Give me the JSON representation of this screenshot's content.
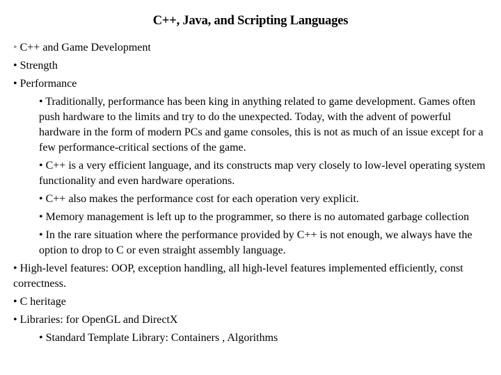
{
  "slide": {
    "title": "C++, Java, and Scripting Languages",
    "items": [
      {
        "level": 1,
        "bullet": "•",
        "bullet_color": "#9a9a9a",
        "text": "C++ and Game Development"
      },
      {
        "level": 1,
        "bullet": "•",
        "text": "Strength"
      },
      {
        "level": 1,
        "bullet": "•",
        "text": "Performance"
      },
      {
        "level": 2,
        "bullet": "•",
        "text": "Traditionally, performance has been king in anything related to game development. Games often push hardware to the limits and try to do the unexpected. Today, with the advent of powerful hardware in the form of modern PCs and game consoles, this is not as much of an issue except for a few performance-critical sections of the game."
      },
      {
        "level": 2,
        "bullet": "•",
        "text": "C++ is a very efficient language, and its constructs map very closely to low-level operating system functionality and even hardware operations."
      },
      {
        "level": 2,
        "bullet": "•",
        "text": "C++ also makes the performance cost for each operation very explicit."
      },
      {
        "level": 2,
        "bullet": "•",
        "text": " Memory management is left up to the programmer, so there is no automated garbage collection"
      },
      {
        "level": 2,
        "bullet": "•",
        "text": " In the rare situation where the performance provided by C++ is not enough, we always have the option to drop to C or even straight assembly language."
      },
      {
        "level": 1,
        "bullet": "•",
        "text": "High-level features: OOP, exception handling, all high-level features implemented efficiently, const correctness."
      },
      {
        "level": 1,
        "bullet": "•",
        "text": "C heritage"
      },
      {
        "level": 1,
        "bullet": "•",
        "text": "Libraries: for OpenGL and DirectX"
      },
      {
        "level": 2,
        "bullet": "•",
        "text": "Standard Template Library: Containers , Algorithms"
      }
    ]
  }
}
